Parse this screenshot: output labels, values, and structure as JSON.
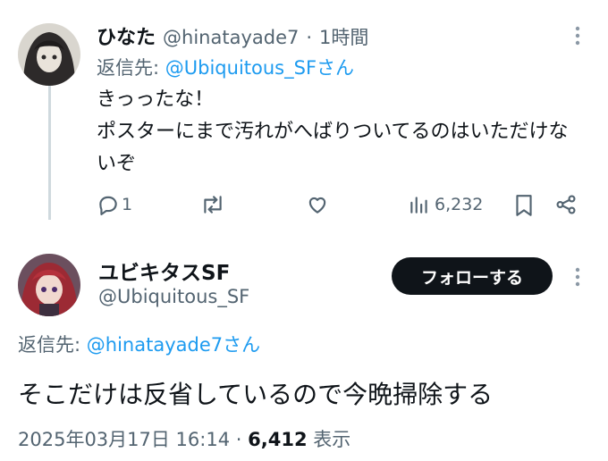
{
  "reply_tweet": {
    "display_name": "ひなた",
    "handle": "@hinatayade7",
    "separator": "·",
    "time": "1時間",
    "replying_prefix": "返信先: ",
    "replying_to": "@Ubiquitous_SFさん",
    "text": "きっったな！\nポスターにまで汚れがへばりついてるのはいただけないぞ",
    "actions": {
      "reply_count": "1",
      "views_count": "6,232"
    }
  },
  "main_tweet": {
    "display_name": "ユビキタスSF",
    "handle": "@Ubiquitous_SF",
    "follow_label": "フォローする",
    "replying_prefix": "返信先: ",
    "replying_to": "@hinatayade7さん",
    "text": "そこだけは反省しているので今晩掃除する",
    "timestamp": "2025年03月17日 16:14",
    "separator": "·",
    "views_count": "6,412",
    "views_label": "表示"
  },
  "colors": {
    "link": "#1d9bf0",
    "secondary_text": "#536471",
    "primary_text": "#0f1419",
    "button_bg": "#0f1419"
  }
}
